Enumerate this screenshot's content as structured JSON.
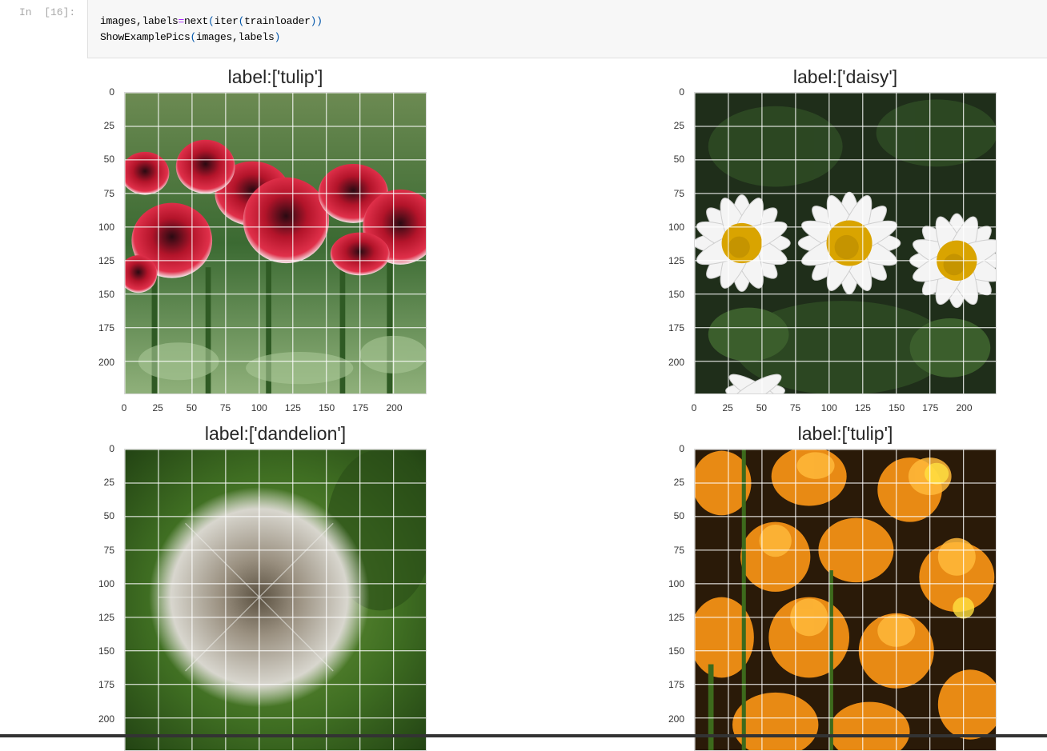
{
  "cell": {
    "prompt": "In  [16]:",
    "line1": {
      "lhs": "images,labels",
      "op": "=",
      "call": "next",
      "p1": "(",
      "inner": "iter",
      "p2": "(",
      "arg": "trainloader",
      "p3": "))"
    },
    "line2": {
      "fn": "ShowExamplePics",
      "p1": "(",
      "args": "images,labels",
      "p2": ")"
    }
  },
  "figure": {
    "panels": [
      {
        "title": "label:['tulip']",
        "image": "red-tulips-photo"
      },
      {
        "title": "label:['daisy']",
        "image": "white-daisies-photo"
      },
      {
        "title": "label:['dandelion']",
        "image": "dandelion-seedhead-photo"
      },
      {
        "title": "label:['tulip']",
        "image": "orange-tulips-photo"
      }
    ],
    "yticks": [
      "0",
      "25",
      "50",
      "75",
      "100",
      "125",
      "150",
      "175",
      "200"
    ],
    "xticks": [
      "0",
      "25",
      "50",
      "75",
      "100",
      "125",
      "150",
      "175",
      "200"
    ],
    "image_extent": [
      0,
      224
    ],
    "grid": true,
    "grid_color": "#ffffff"
  }
}
